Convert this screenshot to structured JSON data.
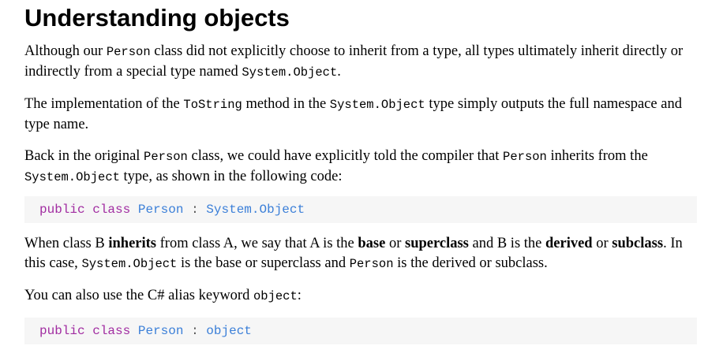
{
  "heading": "Understanding objects",
  "para1": {
    "t1": "Although our ",
    "c1": "Person",
    "t2": " class did not explicitly choose to inherit from a type, all types ultimately inherit directly or indirectly from a special type named ",
    "c2": "System.Object",
    "t3": "."
  },
  "para2": {
    "t1": "The implementation of the ",
    "c1": "ToString",
    "t2": " method in the ",
    "c2": "System.Object",
    "t3": " type simply outputs the full namespace and type name."
  },
  "para3": {
    "t1": "Back in the original ",
    "c1": "Person",
    "t2": " class, we could have explicitly told the compiler that ",
    "c2": "Person",
    "t3": " inherits from the ",
    "c3": "System.Object",
    "t4": " type, as shown in the following code:"
  },
  "code1": {
    "kw1": "public",
    "kw2": "class",
    "type1": "Person",
    "sep": ":",
    "type2": "System.Object"
  },
  "para4": {
    "t1": "When class B ",
    "b1": "inherits",
    "t2": " from class A, we say that A is the ",
    "b2": "base",
    "t3": " or ",
    "b3": "superclass",
    "t4": " and B is the ",
    "b4": "derived",
    "t5": " or ",
    "b5": "subclass",
    "t6": ". In this case, ",
    "c1": "System.Object",
    "t7": " is the base or superclass and ",
    "c2": "Person",
    "t8": " is the derived or subclass."
  },
  "para5": {
    "t1": "You can also use the C# alias keyword ",
    "c1": "object",
    "t2": ":"
  },
  "code2": {
    "kw1": "public",
    "kw2": "class",
    "type1": "Person",
    "sep": ":",
    "type2": "object"
  },
  "colors": {
    "keyword": "#a12ca1",
    "type": "#3b7fd8",
    "code_background": "#f6f6f6"
  }
}
